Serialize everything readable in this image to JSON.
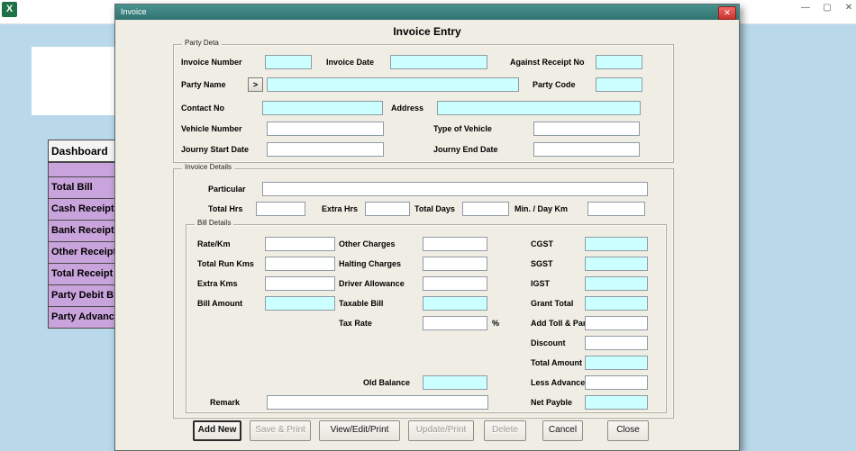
{
  "colors": {
    "desktop_bg": "#b9d9eb",
    "dialog_titlebar": "#37807e",
    "cyan_input": "#ccffff",
    "sidebar_row": "#c9a3db",
    "close_red": "#d64541",
    "dialog_face": "#f0eee4"
  },
  "excel": {
    "app_icon": "X",
    "controls": {
      "minimize": "—",
      "maximize": "▢",
      "close": "✕"
    },
    "sidebar": {
      "header": "Dashboard",
      "items": [
        "Total  Bill",
        "Cash Receipt",
        "Bank Receipt",
        "Other Receipt",
        "Total Receipt",
        "Party Debit Bi",
        "Party Advanc"
      ]
    }
  },
  "dialog": {
    "title": "Invoice",
    "close": "✕",
    "heading": "Invoice Entry",
    "party": {
      "label": "Party Deta",
      "invoice_number": "Invoice Number",
      "invoice_date": "Invoice Date",
      "against_receipt_no": "Against Receipt No",
      "party_name": "Party Name",
      "lookup_button": ">",
      "party_code": "Party Code",
      "contact_no": "Contact No",
      "address": "Address",
      "vehicle_number": "Vehicle Number",
      "type_of_vehicle": "Type of Vehicle",
      "journy_start_date": "Journy Start Date",
      "journy_end_date": "Journy End Date"
    },
    "invoice_details": {
      "label": "Invoice Details",
      "particular": "Particular",
      "total_hrs": "Total Hrs",
      "extra_hrs": "Extra Hrs",
      "total_days": "Total Days",
      "min_day_km": "Min. / Day Km"
    },
    "bill": {
      "label": "Bill Details",
      "rate_km": "Rate/Km",
      "total_run_kms": "Total Run Kms",
      "extra_kms": "Extra Kms",
      "bill_amount": "Bill Amount",
      "other_charges": "Other Charges",
      "halting_charges": "Halting Charges",
      "driver_allowance": "Driver Allowance",
      "taxable_bill": "Taxable Bill",
      "tax_rate": "Tax Rate",
      "percent": "%",
      "old_balance": "Old Balance",
      "cgst": "CGST",
      "sgst": "SGST",
      "igst": "IGST",
      "grant_total": "Grant Total",
      "add_toll_parking": "Add Toll & Parking",
      "discount": "Discount",
      "total_amount": "Total Amount",
      "less_advance": "Less Advance",
      "net_payble": "Net Payble",
      "remark": "Remark"
    },
    "buttons": {
      "add_new": "Add New",
      "save_print": "Save & Print",
      "view_edit_print": "View/Edit/Print",
      "update_print": "Update/Print",
      "delete": "Delete",
      "cancel": "Cancel",
      "close": "Close"
    }
  }
}
